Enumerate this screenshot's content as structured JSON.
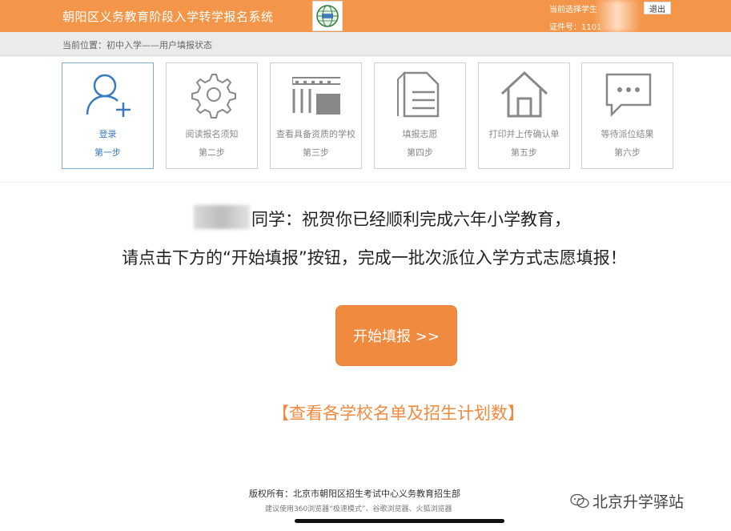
{
  "header": {
    "title": "朝阳区义务教育阶段入学转学报名系统",
    "user_label": "当前选择学生",
    "id_label": "证件号：1101",
    "logout_label": "退出",
    "bg_color": "#f39649"
  },
  "breadcrumb": {
    "text": "当前位置：初中入学——用户填报状态"
  },
  "steps": [
    {
      "icon": "user-add-icon",
      "label": "登录",
      "num": "第一步",
      "active": true
    },
    {
      "icon": "gear-icon",
      "label": "阅读报名须知",
      "num": "第二步",
      "active": false
    },
    {
      "icon": "building-icon",
      "label": "查看具备资质的学校",
      "num": "第三步",
      "active": false
    },
    {
      "icon": "document-icon",
      "label": "填报志愿",
      "num": "第四步",
      "active": false
    },
    {
      "icon": "home-icon",
      "label": "打印并上传确认单",
      "num": "第五步",
      "active": false
    },
    {
      "icon": "chat-icon",
      "label": "等待派位结果",
      "num": "第六步",
      "active": false
    }
  ],
  "main": {
    "line1": "同学：祝贺你已经顺利完成六年小学教育，",
    "line2": "请点击下方的“开始填报”按钮，完成一批次派位入学方式志愿填报！",
    "start_button": "开始填报 >>",
    "school_link": "【查看各学校名单及招生计划数】",
    "accent_color": "#f08a3e"
  },
  "footer": {
    "copyright": "版权所有：北京市朝阳区招生考试中心义务教育招生部",
    "browser_tip": "建议使用360浏览器“极速模式”、谷歌浏览器、火狐浏览器"
  },
  "watermark": {
    "text": "北京升学驿站"
  }
}
